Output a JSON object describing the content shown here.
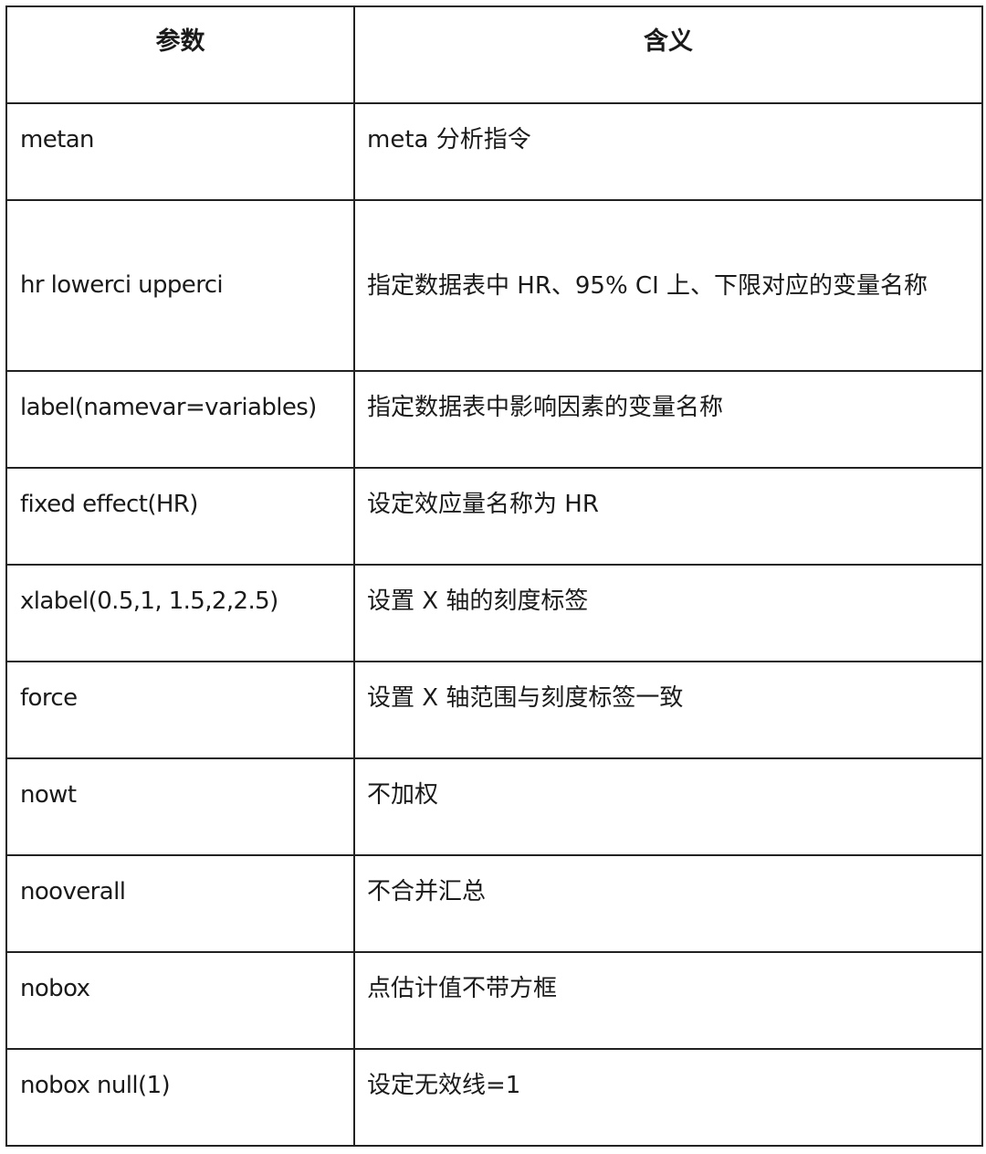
{
  "table": {
    "headers": {
      "param": "参数",
      "meaning": "含义"
    },
    "rows": [
      {
        "param": "metan",
        "meaning": "meta 分析指令"
      },
      {
        "param": "hr lowerci upperci",
        "meaning": "指定数据表中 HR、95% CI 上、下限对应的变量名称"
      },
      {
        "param": "label(namevar=variables)",
        "meaning": "指定数据表中影响因素的变量名称"
      },
      {
        "param": "fixed effect(HR)",
        "meaning": "设定效应量名称为 HR"
      },
      {
        "param": "xlabel(0.5,1, 1.5,2,2.5)",
        "meaning": "设置 X 轴的刻度标签"
      },
      {
        "param": "force",
        "meaning": "设置 X 轴范围与刻度标签一致"
      },
      {
        "param": "nowt",
        "meaning": "不加权"
      },
      {
        "param": "nooverall",
        "meaning": "不合并汇总"
      },
      {
        "param": "nobox",
        "meaning": "点估计值不带方框"
      },
      {
        "param": "nobox null(1)",
        "meaning": "设定无效线=1"
      }
    ]
  }
}
